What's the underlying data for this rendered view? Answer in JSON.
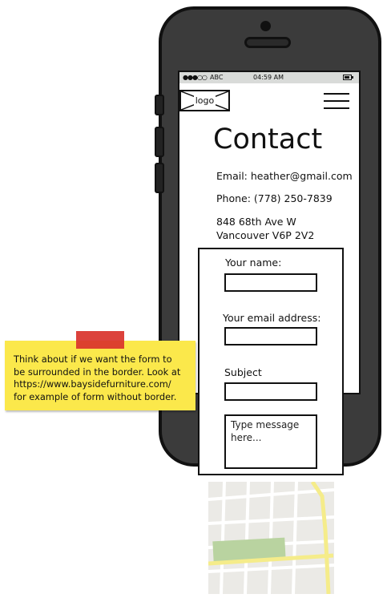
{
  "status_bar": {
    "signal": "●●●○○",
    "carrier": "ABC",
    "time": "04:59 AM"
  },
  "header": {
    "logo_text": "logo",
    "menu_icon": "hamburger-menu-icon"
  },
  "page": {
    "title": "Contact",
    "email": "Email: heather@gmail.com",
    "phone": "Phone: (778) 250-7839",
    "address_line1": "848 68th Ave W",
    "address_line2": "Vancouver V6P 2V2"
  },
  "form": {
    "name_label": "Your name:",
    "email_label": "Your email address:",
    "subject_label": "Subject",
    "message_placeholder": "Type message here..."
  },
  "note": {
    "text_line1": "Think about if we want the form to",
    "text_line2": "be surrounded in the border. Look at",
    "text_line3": "https://www.baysidefurniture.com/",
    "text_line4": "for example of form without border."
  },
  "colors": {
    "phone_body": "#3b3b3b",
    "status_bar": "#d9dbd9",
    "sticky_note": "#fbe84b",
    "tape": "#d9322b",
    "map_road": "#f5ec8a",
    "map_park": "#b9d3a0"
  }
}
